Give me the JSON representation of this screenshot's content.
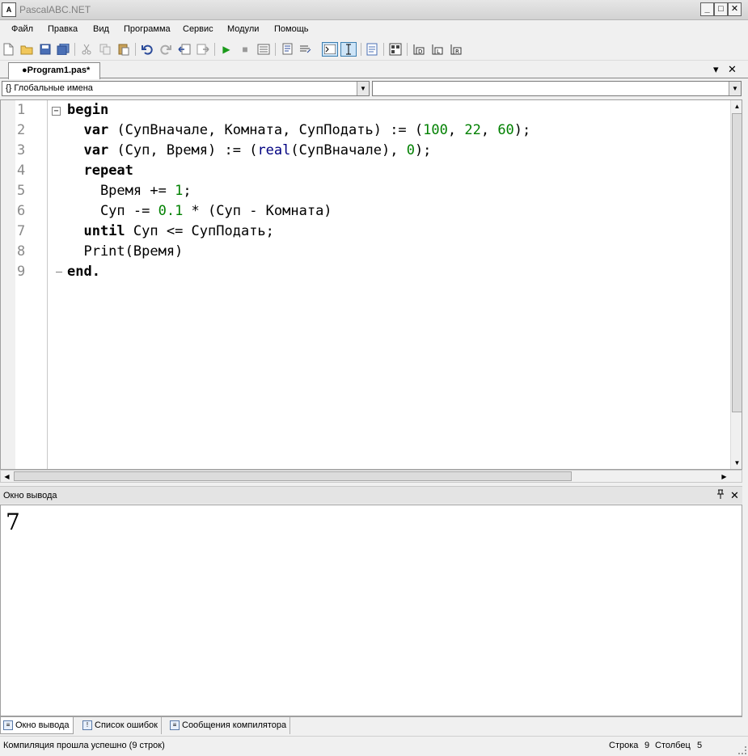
{
  "window": {
    "title": "PascalABC.NET",
    "app_icon": "pascal-app-icon",
    "buttons": {
      "minimize": "_",
      "maximize": "□",
      "close": "✕"
    }
  },
  "menu": [
    "Файл",
    "Правка",
    "Вид",
    "Программа",
    "Сервис",
    "Модули",
    "Помощь"
  ],
  "toolbar": {
    "icons": [
      "new-file-icon",
      "open-icon",
      "save-icon",
      "save-all-icon",
      "cut-icon",
      "copy-icon",
      "paste-icon",
      "undo-icon",
      "redo-icon",
      "navigate-back-icon",
      "navigate-forward-icon",
      "run-icon",
      "stop-icon",
      "compile-icon",
      "comment-icon",
      "uncomment-icon",
      "console-icon",
      "text-cursor-icon",
      "format-icon",
      "debug-icon",
      "step-over-icon",
      "step-into-icon",
      "step-run-icon"
    ],
    "glyphs": {
      "run": "▶",
      "stop": "■"
    }
  },
  "document_tab": {
    "label": "●Program1.pas*"
  },
  "tab_controls": {
    "dropdown": "▾",
    "close": "✕"
  },
  "navbar": {
    "scope_combo": "{} Глобальные имена",
    "member_combo": "",
    "arrow": "▼"
  },
  "editor": {
    "fold_glyph": "−",
    "line_numbers": [
      "1",
      "2",
      "3",
      "4",
      "5",
      "6",
      "7",
      "8",
      "9"
    ],
    "lines": [
      [
        {
          "t": "begin",
          "c": "kw"
        }
      ],
      [
        {
          "t": "  "
        },
        {
          "t": "var",
          "c": "kw"
        },
        {
          "t": " (СупВначале, Комната, СупПодать) := ("
        },
        {
          "t": "100",
          "c": "num"
        },
        {
          "t": ", "
        },
        {
          "t": "22",
          "c": "num"
        },
        {
          "t": ", "
        },
        {
          "t": "60",
          "c": "num"
        },
        {
          "t": ");"
        }
      ],
      [
        {
          "t": "  "
        },
        {
          "t": "var",
          "c": "kw"
        },
        {
          "t": " (Суп, Время) := ("
        },
        {
          "t": "real",
          "c": "fn"
        },
        {
          "t": "(СупВначале), "
        },
        {
          "t": "0",
          "c": "num"
        },
        {
          "t": ");"
        }
      ],
      [
        {
          "t": "  "
        },
        {
          "t": "repeat",
          "c": "kw"
        }
      ],
      [
        {
          "t": "    Время += "
        },
        {
          "t": "1",
          "c": "num"
        },
        {
          "t": ";"
        }
      ],
      [
        {
          "t": "    Суп -= "
        },
        {
          "t": "0.1",
          "c": "num"
        },
        {
          "t": " * (Суп - Комната)"
        }
      ],
      [
        {
          "t": "  "
        },
        {
          "t": "until",
          "c": "kw"
        },
        {
          "t": " Суп <= СупПодать;"
        }
      ],
      [
        {
          "t": "  Print(Время)"
        }
      ],
      [
        {
          "t": "end.",
          "c": "kw"
        }
      ]
    ]
  },
  "scroll_arrows": {
    "up": "▲",
    "down": "▼",
    "left": "◀",
    "right": "▶"
  },
  "output_panel": {
    "title": "Окно вывода",
    "pin": "📌",
    "close": "✕",
    "text": "7"
  },
  "bottom_tabs": [
    "Окно вывода",
    "Список ошибок",
    "Сообщения компилятора"
  ],
  "status": {
    "message": "Компиляция прошла успешно (9 строк)",
    "row_label": "Строка",
    "row_value": "9",
    "col_label": "Столбец",
    "col_value": "5"
  }
}
